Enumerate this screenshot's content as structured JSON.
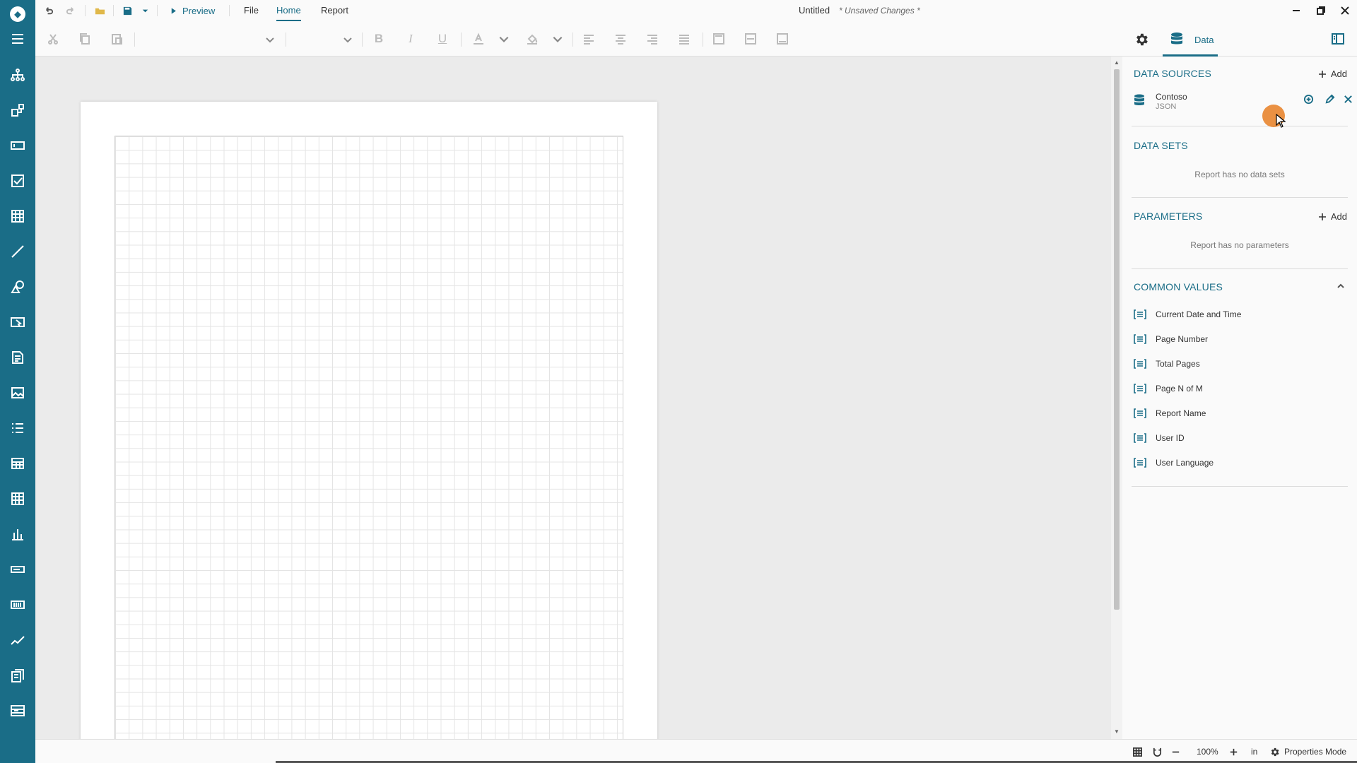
{
  "titlebar": {
    "preview_label": "Preview",
    "menus": [
      "File",
      "Home",
      "Report"
    ],
    "document_title": "Untitled",
    "unsaved_label": "* Unsaved Changes *"
  },
  "panel_tabs": {
    "data_label": "Data"
  },
  "data_sources": {
    "title": "DATA SOURCES",
    "add_label": "Add",
    "items": [
      {
        "name": "Contoso",
        "type": "JSON"
      }
    ]
  },
  "data_sets": {
    "title": "DATA SETS",
    "empty_text": "Report has no data sets"
  },
  "parameters": {
    "title": "PARAMETERS",
    "add_label": "Add",
    "empty_text": "Report has no parameters"
  },
  "common_values": {
    "title": "COMMON VALUES",
    "items": [
      "Current Date and Time",
      "Page Number",
      "Total Pages",
      "Page N of M",
      "Report Name",
      "User ID",
      "User Language"
    ]
  },
  "statusbar": {
    "zoom": "100%",
    "unit": "in",
    "mode_label": "Properties Mode"
  },
  "colors": {
    "accent": "#1a6d87",
    "cursor_highlight": "#e67e22"
  }
}
